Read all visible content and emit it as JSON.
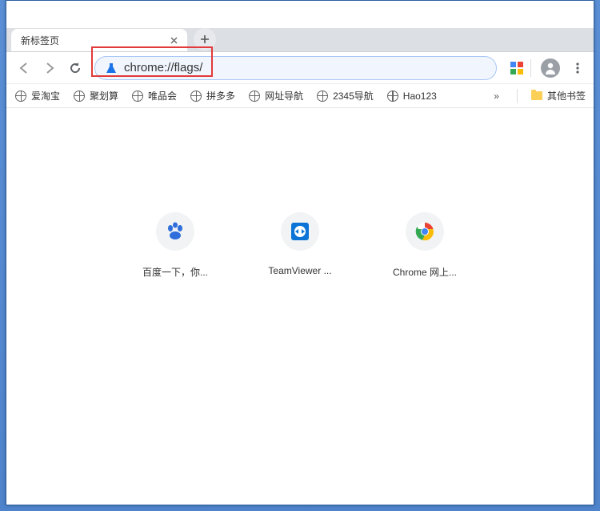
{
  "tab": {
    "title": "新标签页"
  },
  "omnibox": {
    "url": "chrome://flags/"
  },
  "bookmarks": {
    "items": [
      {
        "label": "爱淘宝"
      },
      {
        "label": "聚划算"
      },
      {
        "label": "唯品会"
      },
      {
        "label": "拼多多"
      },
      {
        "label": "网址导航"
      },
      {
        "label": "2345导航"
      },
      {
        "label": "Hao123"
      }
    ],
    "overflow": "»",
    "other": "其他书签"
  },
  "tiles": [
    {
      "label": "百度一下，你..."
    },
    {
      "label": "TeamViewer ..."
    },
    {
      "label": "Chrome 网上..."
    }
  ]
}
